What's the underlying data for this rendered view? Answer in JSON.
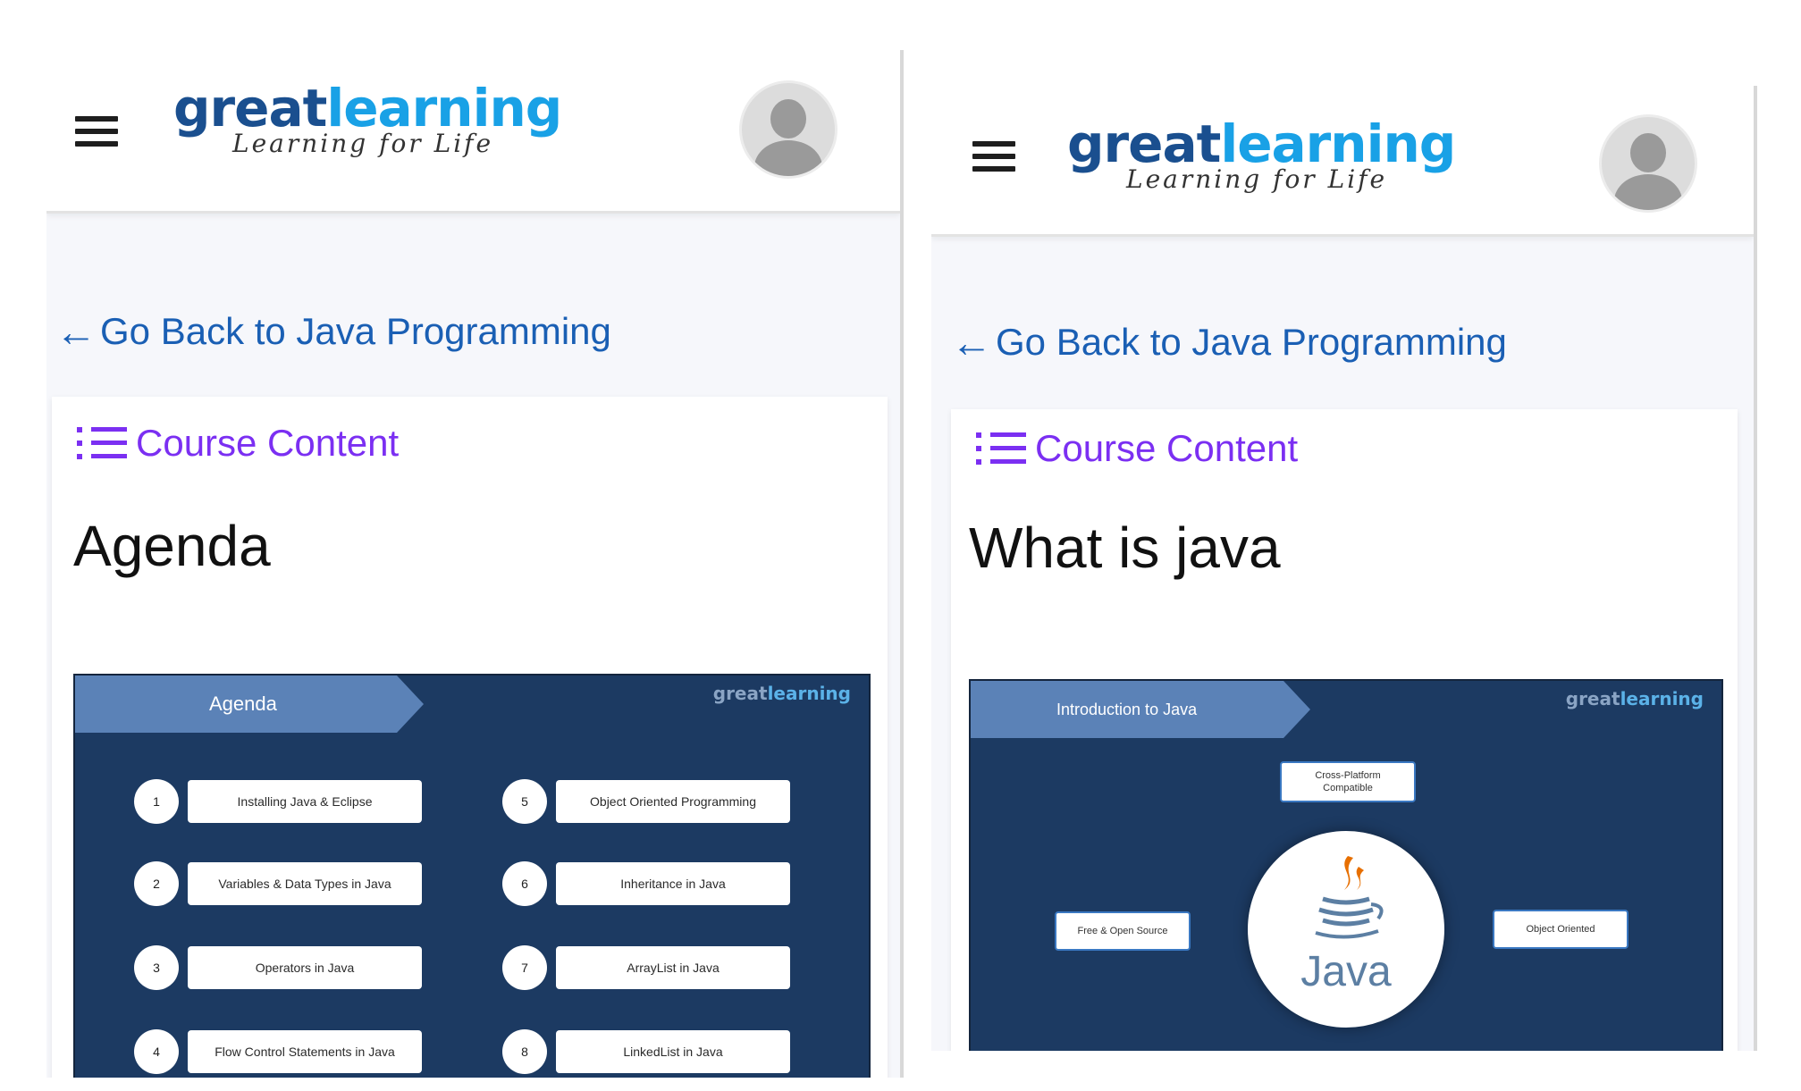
{
  "screens": [
    {
      "logo": {
        "part1": "great",
        "part2": "learning",
        "tagline": "Learning for Life"
      },
      "back_link": {
        "arrow": "←",
        "label": "Go Back to Java Programming"
      },
      "course_content_label": "Course Content",
      "heading": "Agenda",
      "slide": {
        "banner": "Agenda",
        "logo": {
          "part1": "great",
          "part2": "learning"
        },
        "items": [
          {
            "num": "1",
            "label": "Installing Java & Eclipse"
          },
          {
            "num": "2",
            "label": "Variables & Data Types in Java"
          },
          {
            "num": "3",
            "label": "Operators in Java"
          },
          {
            "num": "4",
            "label": "Flow Control Statements in Java"
          },
          {
            "num": "5",
            "label": "Object Oriented Programming"
          },
          {
            "num": "6",
            "label": "Inheritance in Java"
          },
          {
            "num": "7",
            "label": "ArrayList in Java"
          },
          {
            "num": "8",
            "label": "LinkedList in Java"
          }
        ]
      }
    },
    {
      "logo": {
        "part1": "great",
        "part2": "learning",
        "tagline": "Learning for Life"
      },
      "back_link": {
        "arrow": "←",
        "label": "Go Back to Java Programming"
      },
      "course_content_label": "Course Content",
      "heading": "What is java",
      "slide": {
        "banner": "Introduction to Java",
        "logo": {
          "part1": "great",
          "part2": "learning"
        },
        "center_label": "Java",
        "features": {
          "top": "Cross-Platform\nCompatible",
          "left": "Free & Open Source",
          "right": "Object Oriented"
        }
      }
    }
  ],
  "colors": {
    "logo_dark": "#1a4f8f",
    "logo_light": "#19a1e6",
    "link": "#1a5fb4",
    "accent_purple": "#7b2ff2",
    "slide_bg": "#1c3a62",
    "slide_banner": "#5b82b7"
  },
  "icons": [
    "hamburger-menu-icon",
    "avatar-placeholder-icon",
    "back-arrow-icon",
    "list-icon",
    "java-cup-icon"
  ]
}
